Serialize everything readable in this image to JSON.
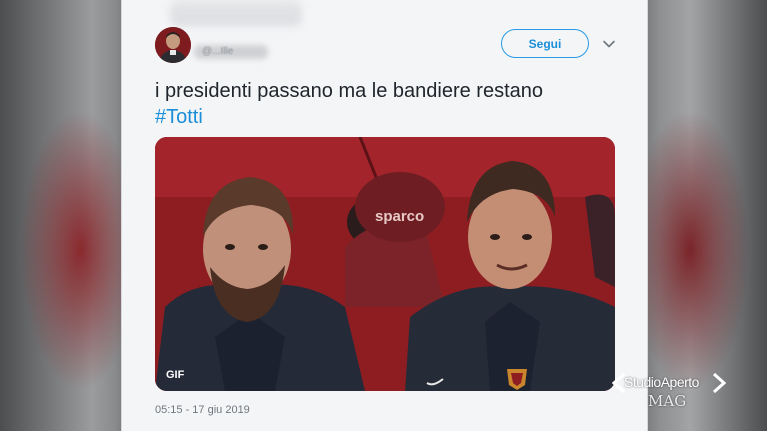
{
  "tweet": {
    "text": "i presidenti passano ma le bandiere restano",
    "hashtag": "#Totti",
    "follow_label": "Segui",
    "handle": "@...Ille",
    "timestamp": "05:15 - 17 giu 2019",
    "media": {
      "badge": "GIF",
      "jersey_sponsor": "sparco"
    }
  },
  "icons": {
    "menu": "chevron-down-icon",
    "avatar": "avatar"
  },
  "broadcast": {
    "logo_line1": "StudioAperto",
    "logo_line2": "MAG"
  },
  "colors": {
    "accent": "#1b8ed8",
    "card_background": "#f4f5f7",
    "text": "#20262c",
    "meta": "#6f777e"
  }
}
